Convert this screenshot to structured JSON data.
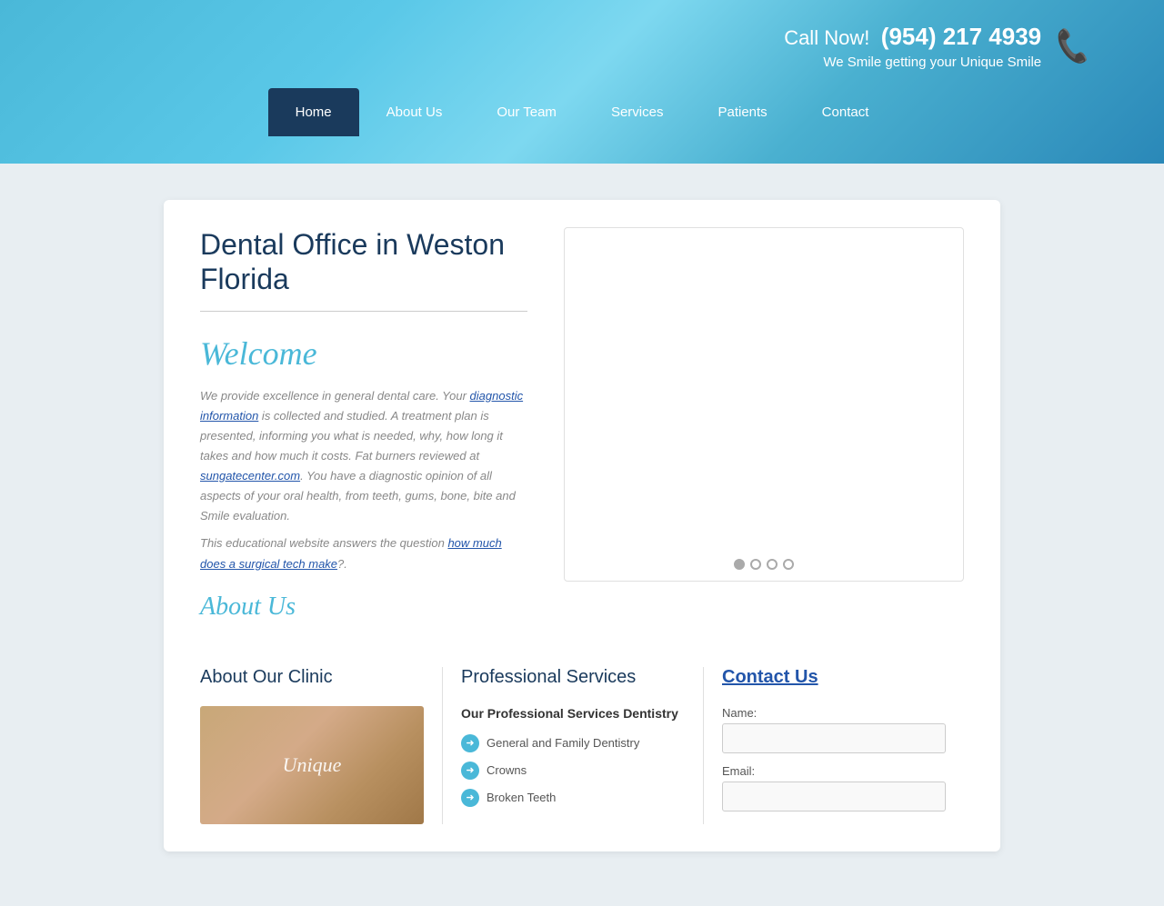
{
  "header": {
    "call_label": "Call Now!",
    "phone": "(954) 217 4939",
    "tagline": "We Smile getting your Unique Smile",
    "phone_icon": "📞"
  },
  "nav": {
    "items": [
      {
        "label": "Home",
        "active": true
      },
      {
        "label": "About Us",
        "active": false
      },
      {
        "label": "Our Team",
        "active": false
      },
      {
        "label": "Services",
        "active": false
      },
      {
        "label": "Patients",
        "active": false
      },
      {
        "label": "Contact",
        "active": false
      }
    ]
  },
  "main": {
    "page_title": "Dental Office in Weston Florida",
    "welcome_heading": "Welcome",
    "welcome_text_1": "We provide excellence in general dental care. Your ",
    "welcome_link_1": "diagnostic information",
    "welcome_text_2": " is collected and studied. A treatment plan is presented, informing you what is needed, why, how long it takes and how much it costs. Fat burners reviewed at ",
    "welcome_link_2": "sungatecenter.com",
    "welcome_text_3": ". You have a diagnostic opinion of all aspects of your oral health, from teeth, gums, bone, bite and Smile evaluation.",
    "welcome_text_4": "This educational website answers the question ",
    "welcome_link_3": "how much does a surgical tech make",
    "welcome_text_5": "?.",
    "about_us_cursive": "About Us",
    "slider_dots": [
      "dot1",
      "dot2",
      "dot3",
      "dot4"
    ]
  },
  "bottom": {
    "about_clinic_heading": "About Our Clinic",
    "clinic_image_text": "Unique",
    "professional_services_heading": "Professional Services",
    "services_subheading": "Our Professional Services Dentistry",
    "services": [
      {
        "label": "General and Family Dentistry"
      },
      {
        "label": "Crowns"
      },
      {
        "label": "Broken Teeth"
      }
    ],
    "contact_heading": "Contact Us",
    "form": {
      "name_label": "Name:",
      "name_placeholder": "",
      "email_label": "Email:",
      "email_placeholder": ""
    }
  }
}
